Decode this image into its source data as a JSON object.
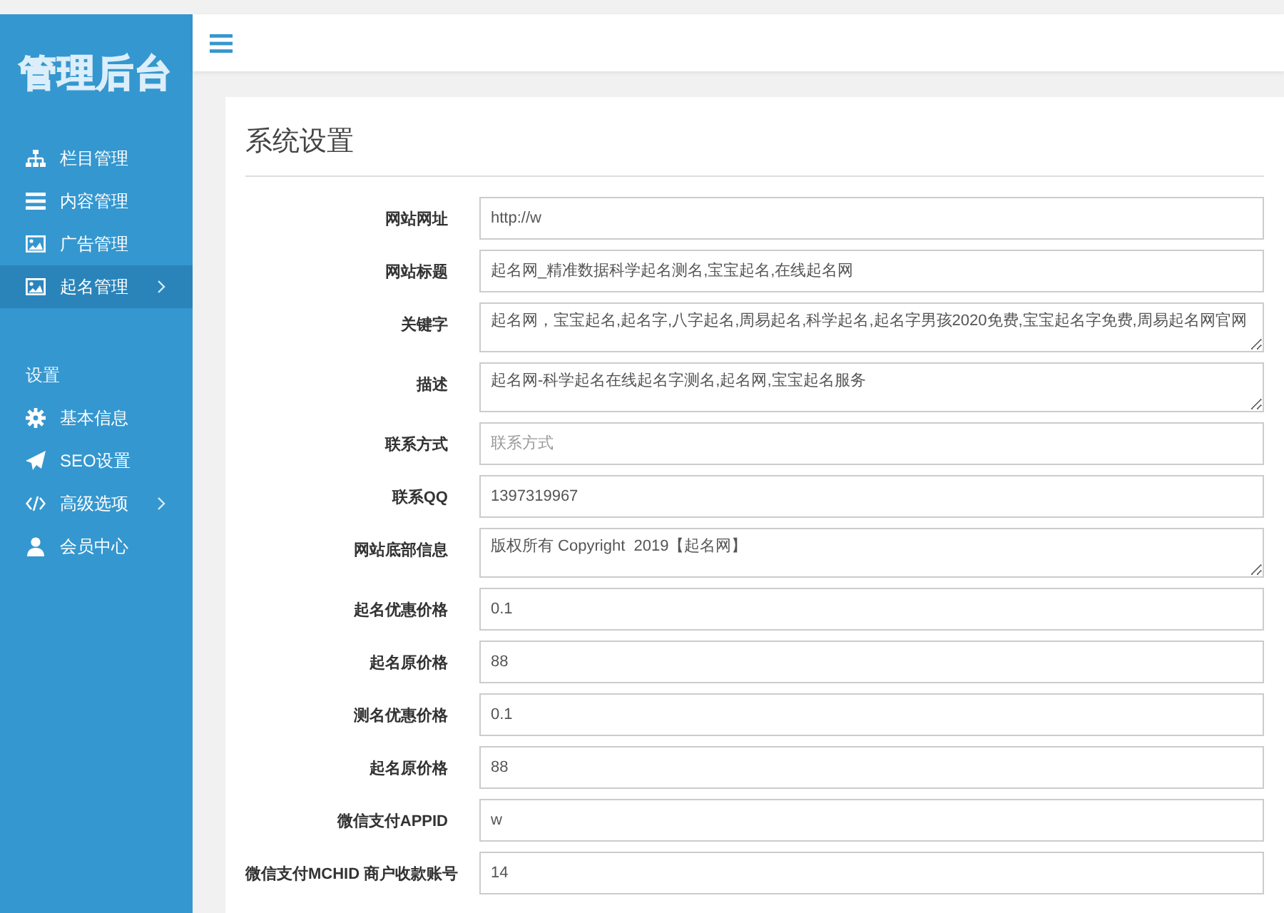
{
  "sidebar": {
    "logo": "管理后台",
    "items": [
      {
        "label": "栏目管理",
        "selected": false,
        "has_submenu": false
      },
      {
        "label": "内容管理",
        "selected": false,
        "has_submenu": false
      },
      {
        "label": "广告管理",
        "selected": false,
        "has_submenu": false
      },
      {
        "label": "起名管理",
        "selected": true,
        "has_submenu": true
      }
    ],
    "section_title": "设置",
    "settings_items": [
      {
        "label": "基本信息",
        "selected": false,
        "has_submenu": false
      },
      {
        "label": "SEO设置",
        "selected": false,
        "has_submenu": false
      },
      {
        "label": "高级选项",
        "selected": false,
        "has_submenu": true
      },
      {
        "label": "会员中心",
        "selected": false,
        "has_submenu": false
      }
    ]
  },
  "page_title": "系统设置",
  "fields": [
    {
      "label": "网站网址",
      "kind": "input",
      "value": "http://w"
    },
    {
      "label": "网站标题",
      "kind": "input",
      "value": "起名网_精准数据科学起名测名,宝宝起名,在线起名网"
    },
    {
      "label": "关键字",
      "kind": "textarea",
      "value": "起名网，宝宝起名,起名字,八字起名,周易起名,科学起名,起名字男孩2020免费,宝宝起名字免费,周易起名网官网"
    },
    {
      "label": "描述",
      "kind": "textarea",
      "value": "起名网-科学起名在线起名字测名,起名网,宝宝起名服务"
    },
    {
      "label": "联系方式",
      "kind": "input",
      "placeholder": "联系方式"
    },
    {
      "label": "联系QQ",
      "kind": "input",
      "value": "1397319967"
    },
    {
      "label": "网站底部信息",
      "kind": "textarea",
      "value": "版权所有 Copyright  2019【起名网】"
    },
    {
      "label": "起名优惠价格",
      "kind": "input",
      "value": "0.1"
    },
    {
      "label": "起名原价格",
      "kind": "input",
      "value": "88"
    },
    {
      "label": "测名优惠价格",
      "kind": "input",
      "value": "0.1"
    },
    {
      "label": "起名原价格",
      "kind": "input",
      "value": "88"
    },
    {
      "label": "微信支付APPID",
      "kind": "input",
      "value": "w"
    },
    {
      "label": "微信支付MCHID 商户收款账号",
      "kind": "input",
      "value": "14"
    }
  ]
}
